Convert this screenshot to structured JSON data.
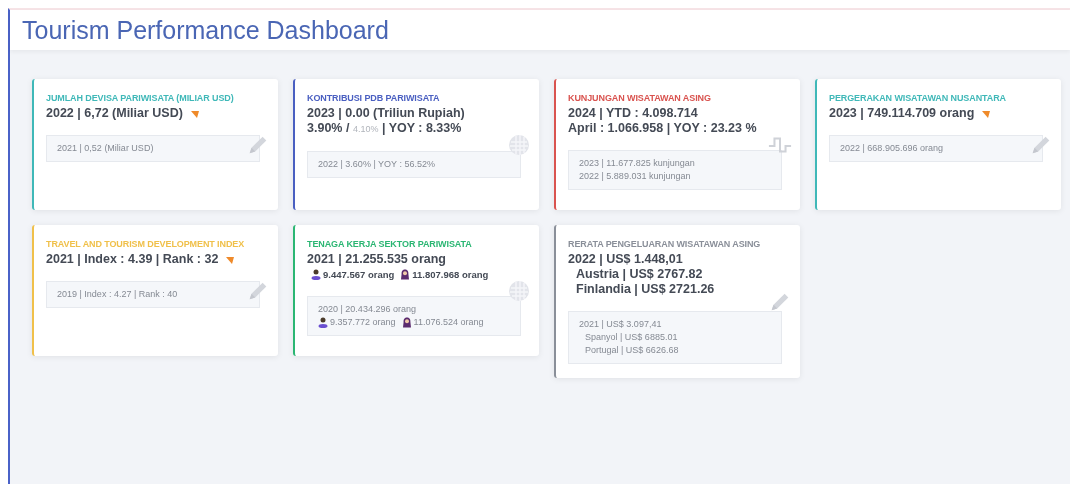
{
  "page": {
    "title": "Tourism Performance Dashboard"
  },
  "cards": [
    {
      "title": "JUMLAH DEVISA PARIWISATA (MILIAR USD)",
      "color": "#3fb8b8",
      "kind": "pencil",
      "lines": [
        {
          "kind": "text",
          "text": "2022 | 6,72 (Miliar USD)",
          "declining": true
        }
      ],
      "details": [
        {
          "kind": "text",
          "text": "2021 | 0,52 (Miliar USD)"
        }
      ]
    },
    {
      "title": "KONTRIBUSI PDB PARIWISATA",
      "color": "#4a5fc1",
      "kind": "globe",
      "lines": [
        {
          "kind": "text",
          "text": "2023 | 0.00 (Triliun Rupiah)"
        },
        {
          "kind": "parts",
          "parts": [
            {
              "text": "3.90% /",
              "muted": false
            },
            {
              "text": "4.10%",
              "muted": true
            },
            {
              "text": "| YOY : 8.33%",
              "muted": false
            }
          ]
        }
      ],
      "details": [
        {
          "kind": "text",
          "text": "2022 | 3.60% | YOY : 56.52%"
        }
      ]
    },
    {
      "title": "KUNJUNGAN WISATAWAN ASING",
      "color": "#d9534f",
      "kind": "pulse",
      "lines": [
        {
          "kind": "text",
          "text": "2024 | YTD : 4.098.714"
        },
        {
          "kind": "text",
          "text": "April : 1.066.958 | YOY : 23.23 %"
        }
      ],
      "details": [
        {
          "kind": "text",
          "text": "2023 | 11.677.825 kunjungan"
        },
        {
          "kind": "text",
          "text": "2022 | 5.889.031 kunjungan"
        }
      ]
    },
    {
      "title": "PERGERAKAN WISATAWAN NUSANTARA",
      "color": "#3fb8b8",
      "kind": "pencil",
      "lines": [
        {
          "kind": "text",
          "text": "2023 | 749.114.709 orang",
          "declining": true
        }
      ],
      "details": [
        {
          "kind": "text",
          "text": "2022 | 668.905.696 orang"
        }
      ]
    },
    {
      "title": "TRAVEL AND TOURISM DEVELOPMENT INDEX",
      "color": "#f0c04a",
      "kind": "pencil",
      "lines": [
        {
          "kind": "text",
          "text": "2021 | Index : 4.39 | Rank : 32",
          "declining": true
        }
      ],
      "details": [
        {
          "kind": "text",
          "text": "2019 | Index : 4.27 | Rank : 40"
        }
      ]
    },
    {
      "title": "TENAGA KERJA SEKTOR PARIWISATA",
      "color": "#2bb673",
      "kind": "globe",
      "lines": [
        {
          "kind": "text",
          "text": "2021 | 21.255.535 orang"
        },
        {
          "kind": "people",
          "male": "9.447.567 orang",
          "female": "11.807.968 orang"
        }
      ],
      "details": [
        {
          "kind": "text",
          "text": "2020 | 20.434.296 orang"
        },
        {
          "kind": "people",
          "male": "9.357.772 orang",
          "female": "11.076.524 orang"
        }
      ]
    },
    {
      "title": "RERATA PENGELUARAN WISATAWAN ASING",
      "color": "#8a8f99",
      "kind": "pencil",
      "lines": [
        {
          "kind": "text",
          "text": "2022 | US$ 1.448,01"
        },
        {
          "kind": "indented",
          "text": "Austria | US$ 2767.82"
        },
        {
          "kind": "indented",
          "text": "Finlandia | US$ 2721.26"
        }
      ],
      "details": [
        {
          "kind": "text",
          "text": "2021 | US$ 3.097,41"
        },
        {
          "kind": "indented",
          "text": "Spanyol | US$ 6885.01"
        },
        {
          "kind": "indented",
          "text": "Portugal | US$ 6626.68"
        }
      ]
    }
  ]
}
